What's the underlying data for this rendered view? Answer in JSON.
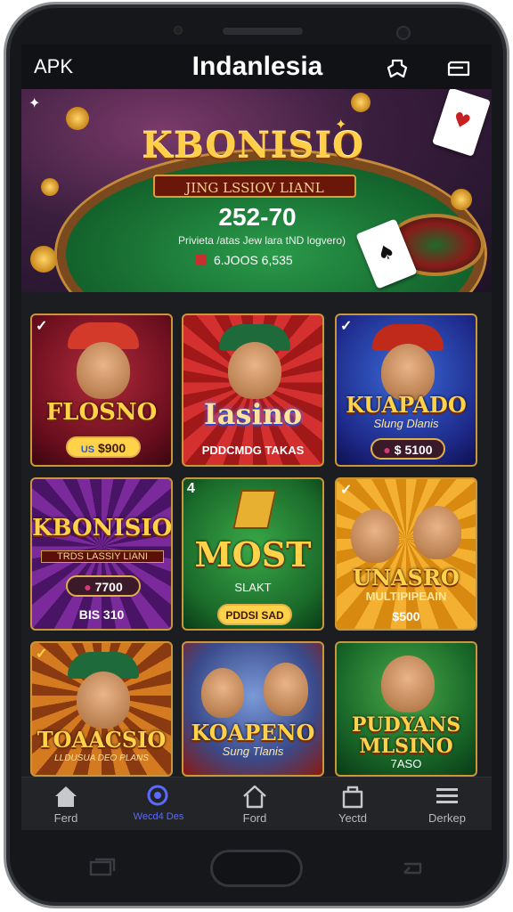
{
  "header": {
    "apk_label": "APK",
    "title": "Indanlesia"
  },
  "banner": {
    "title": "KBONISIO",
    "ribbon": "JING LSSIOV LIANL",
    "number": "252-70",
    "subtitle": "Privieta /atas Jew lara tND logvero)",
    "footer": "6.JOOS 6,535"
  },
  "games": [
    {
      "title": "FLOSNO",
      "button": "$900",
      "button_icon": "US"
    },
    {
      "title": "Iasino",
      "footer": "PDDCMDG TAKAS"
    },
    {
      "title": "KUAPADO",
      "subtitle": "Slung Dlanis",
      "button": "$ 5100"
    },
    {
      "title": "KBONISIO",
      "ribbon": "TRDS LASSIY LIANI",
      "button": "7700",
      "footer": "BIS 310"
    },
    {
      "badge": "4",
      "title": "MOST",
      "subtitle": "SLAKT",
      "button": "PDDSI SAD"
    },
    {
      "title": "UNASRO",
      "ribbon": "MULTIPIPEAIN",
      "footer": "$500"
    },
    {
      "title": "TOAACSIO",
      "ribbon": "LLDUSUA DEO PLANS"
    },
    {
      "title": "KOAPENO",
      "subtitle": "Sung Tlanis"
    },
    {
      "title": "PUDYANS MLSINO",
      "subtitle": "7ASO"
    }
  ],
  "nav": [
    {
      "label": "Ferd",
      "icon": "home-icon"
    },
    {
      "label": "Wecd4 Des",
      "icon": "search-icon",
      "active": true
    },
    {
      "label": "Ford",
      "icon": "home-outline-icon"
    },
    {
      "label": "Yectd",
      "icon": "bag-icon"
    },
    {
      "label": "Derkep",
      "icon": "menu-icon"
    }
  ],
  "colors": {
    "accent": "#5a6aff",
    "gold": "#ffd24a",
    "background": "#18191d"
  }
}
